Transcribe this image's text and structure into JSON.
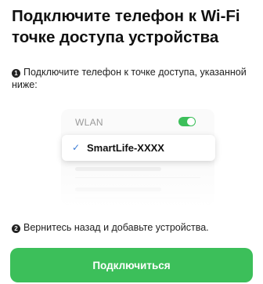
{
  "title": "Подключите телефон к Wi-Fi точке доступа устройства",
  "steps": [
    {
      "number": "1",
      "text": "Подключите телефон к точке доступа, указанной ниже:"
    },
    {
      "number": "2",
      "text": "Вернитесь назад и добавьте устройства."
    }
  ],
  "illustration": {
    "wlan_label": "WLAN",
    "wlan_toggle_on": true,
    "network_name": "SmartLife-XXXX",
    "check_icon": "checkmark-icon"
  },
  "button": {
    "label": "Подключиться"
  },
  "colors": {
    "accent": "#3cbf5a",
    "check": "#3a7bd5"
  }
}
